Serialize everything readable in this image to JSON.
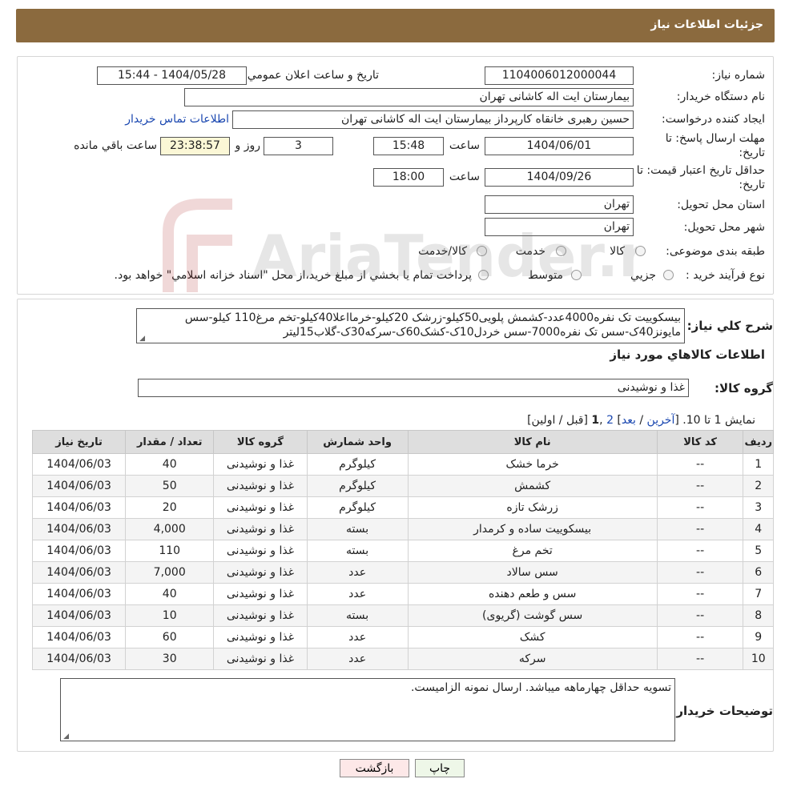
{
  "header": {
    "title": "جزئیات اطلاعات نیاز"
  },
  "form": {
    "need_number_label": "شماره نیاز:",
    "need_number": "1104006012000044",
    "announce_label": "تاريخ و ساعت اعلان عمومي:",
    "announce_value": "1404/05/28 - 15:44",
    "buyer_org_label": "نام دستگاه خريدار:",
    "buyer_org": "بیمارستان ایت اله کاشانی تهران",
    "requester_label": "ايجاد کننده درخواست:",
    "requester": "حسین رهبری خانقاه کارپرداز بیمارستان ایت اله کاشانی تهران",
    "contact_link": "اطلاعات تماس خريدار",
    "deadline_label_1": "مهلت ارسال پاسخ: تا",
    "deadline_label_2": "تاريخ:",
    "deadline_date": "1404/06/01",
    "time_label": "ساعت",
    "deadline_time": "15:48",
    "days_value": "3",
    "days_label": "روز و",
    "remaining_time": "23:38:57",
    "remaining_label": "ساعت باقي مانده",
    "validity_label_1": "حداقل تاريخ اعتبار قيمت: تا",
    "validity_label_2": "تاريخ:",
    "validity_date": "1404/09/26",
    "validity_time": "18:00",
    "province_label": "استان محل تحويل:",
    "province": "تهران",
    "city_label": "شهر محل تحويل:",
    "city": "تهران",
    "category_label": "طبقه بندی موضوعی:",
    "category_options": [
      "کالا",
      "خدمت",
      "کالا/خدمت"
    ],
    "process_label": "نوع فرآيند خريد :",
    "process_options": [
      "جزيي",
      "متوسط"
    ],
    "process_note": "پرداخت تمام يا بخشي از مبلغ خريد،از محل \"اسناد خزانه اسلامي\" خواهد بود."
  },
  "watermark": {
    "text": "AriaTender.neT"
  },
  "details": {
    "summary_label": "شرح کلي نياز:",
    "summary_text": "بیسکوییت تک نفره4000عدد-کشمش پلویی50کیلو-زرشک 20کیلو-خرمااعلا40کیلو-تخم مرغ110 کیلو-سس مایونز40ک-سس تک نفره7000-سس خردل10ک-کشک60ک-سرکه30ک-گلاب15لیتر",
    "goods_info_title": "اطلاعات کالاهاي مورد نياز",
    "goods_group_label": "گروه کالا:",
    "goods_group": "غذا و نوشیدنی",
    "pager": {
      "showing": "نمايش 1 تا 10.",
      "last": "آخرين",
      "next": "بعد",
      "page2": "2",
      "current": "1",
      "prev_first": "قبل / اولين"
    },
    "table": {
      "headers": [
        "رديف",
        "کد کالا",
        "نام کالا",
        "واحد شمارش",
        "گروه کالا",
        "تعداد / مقدار",
        "تاريخ نياز"
      ],
      "rows": [
        [
          "1",
          "--",
          "خرما خشک",
          "کیلوگرم",
          "غذا و نوشیدنی",
          "40",
          "1404/06/03"
        ],
        [
          "2",
          "--",
          "کشمش",
          "کیلوگرم",
          "غذا و نوشیدنی",
          "50",
          "1404/06/03"
        ],
        [
          "3",
          "--",
          "زرشک تازه",
          "کیلوگرم",
          "غذا و نوشیدنی",
          "20",
          "1404/06/03"
        ],
        [
          "4",
          "--",
          "بیسکوییت ساده و کرمدار",
          "بسته",
          "غذا و نوشیدنی",
          "4,000",
          "1404/06/03"
        ],
        [
          "5",
          "--",
          "تخم مرغ",
          "بسته",
          "غذا و نوشیدنی",
          "110",
          "1404/06/03"
        ],
        [
          "6",
          "--",
          "سس سالاد",
          "عدد",
          "غذا و نوشیدنی",
          "7,000",
          "1404/06/03"
        ],
        [
          "7",
          "--",
          "سس و طعم دهنده",
          "عدد",
          "غذا و نوشیدنی",
          "40",
          "1404/06/03"
        ],
        [
          "8",
          "--",
          "سس گوشت (گریوی)",
          "بسته",
          "غذا و نوشیدنی",
          "10",
          "1404/06/03"
        ],
        [
          "9",
          "--",
          "کشک",
          "عدد",
          "غذا و نوشیدنی",
          "60",
          "1404/06/03"
        ],
        [
          "10",
          "--",
          "سرکه",
          "عدد",
          "غذا و نوشیدنی",
          "30",
          "1404/06/03"
        ]
      ]
    },
    "buyer_notes_label": "توضيحات خريدار:",
    "buyer_notes": "تسویه حداقل چهارماهه میباشد. ارسال نمونه الزامیست."
  },
  "buttons": {
    "print": "چاپ",
    "back": "بازگشت"
  }
}
